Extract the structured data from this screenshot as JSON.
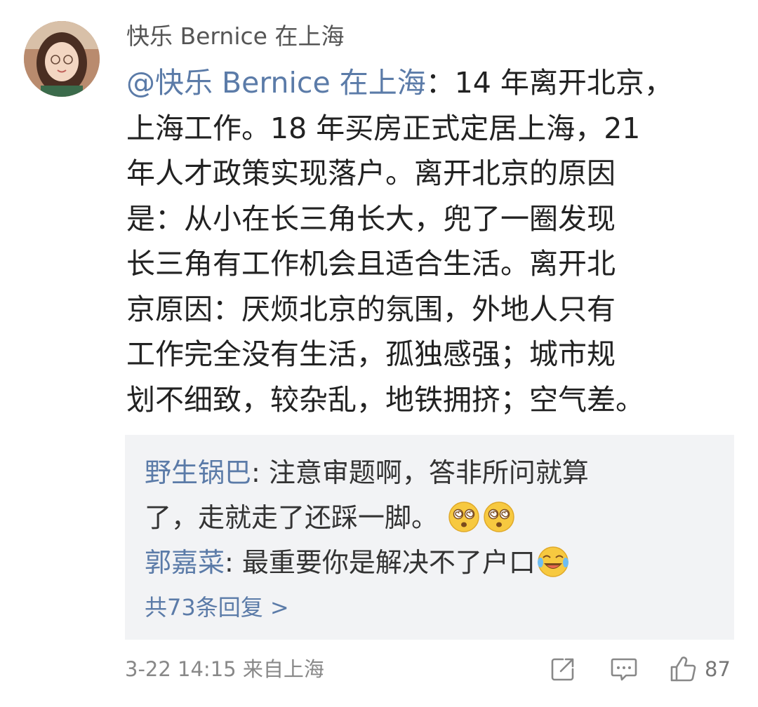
{
  "comment": {
    "author": "快乐 Bernice 在上海",
    "mention": "@快乐 Bernice 在上海",
    "body_lines": [
      "：14 年离开北京，",
      "上海工作。18 年买房正式定居上海，21",
      "年人才政策实现落户。离开北京的原因",
      "是：从小在长三角长大，兜了一圈发现",
      "长三角有工作机会且适合生活。离开北",
      "京原因：厌烦北京的氛围，外地人只有",
      "工作完全没有生活，孤独感强；城市规",
      "划不细致，较杂乱，地铁拥挤；空气差。"
    ],
    "timestamp": "3-22 14:15",
    "location": "来自上海",
    "like_count": "87"
  },
  "replies": [
    {
      "user": "野生锅巴",
      "line1": ": 注意审题啊，答非所问就算",
      "line2": "了，走就走了还踩一脚。",
      "emojis": [
        "dizzy-face-emoji",
        "dizzy-face-emoji"
      ]
    },
    {
      "user": "郭嘉菜",
      "text": ": 最重要你是解决不了户口",
      "emojis": [
        "crying-laughing-emoji"
      ]
    }
  ],
  "more_replies": "共73条回复 >",
  "icons": {
    "share": "share-icon",
    "comment": "comment-icon",
    "like": "thumbs-up-icon"
  },
  "colors": {
    "link_blue": "#5b7ba8",
    "reply_bg": "#f2f3f5",
    "meta_gray": "#888888"
  }
}
